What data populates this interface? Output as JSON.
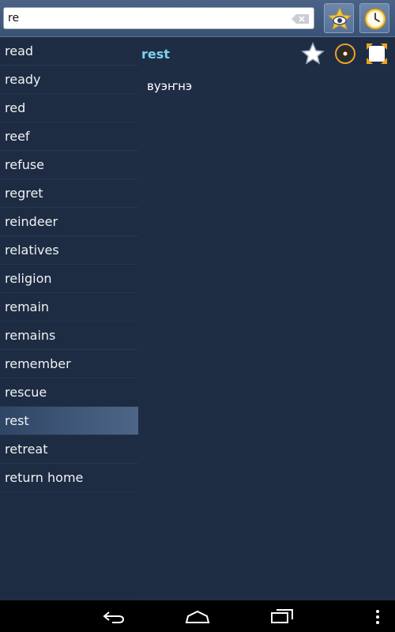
{
  "search": {
    "value": "re",
    "placeholder": ""
  },
  "word_list": [
    {
      "label": "read"
    },
    {
      "label": "ready"
    },
    {
      "label": "red"
    },
    {
      "label": "reef"
    },
    {
      "label": "refuse"
    },
    {
      "label": "regret"
    },
    {
      "label": "reindeer"
    },
    {
      "label": "relatives"
    },
    {
      "label": "religion"
    },
    {
      "label": "remain"
    },
    {
      "label": "remains"
    },
    {
      "label": "remember"
    },
    {
      "label": "rescue"
    },
    {
      "label": "rest",
      "selected": true
    },
    {
      "label": "retreat"
    },
    {
      "label": "return home"
    }
  ],
  "detail": {
    "word": "rest",
    "translation": "вуэҥнэ"
  },
  "icons": {
    "toolbar": [
      "favorites-star-eye-icon",
      "history-clock-icon"
    ],
    "detail": [
      "add-favorite-star-icon",
      "speak-audio-icon",
      "fullscreen-icon"
    ],
    "navbar": [
      "back-icon",
      "home-icon",
      "recent-apps-icon",
      "overflow-menu-icon"
    ]
  },
  "colors": {
    "background": "#1e2d44",
    "accent_word": "#7fd0ee",
    "topbar": "#3a5274"
  }
}
